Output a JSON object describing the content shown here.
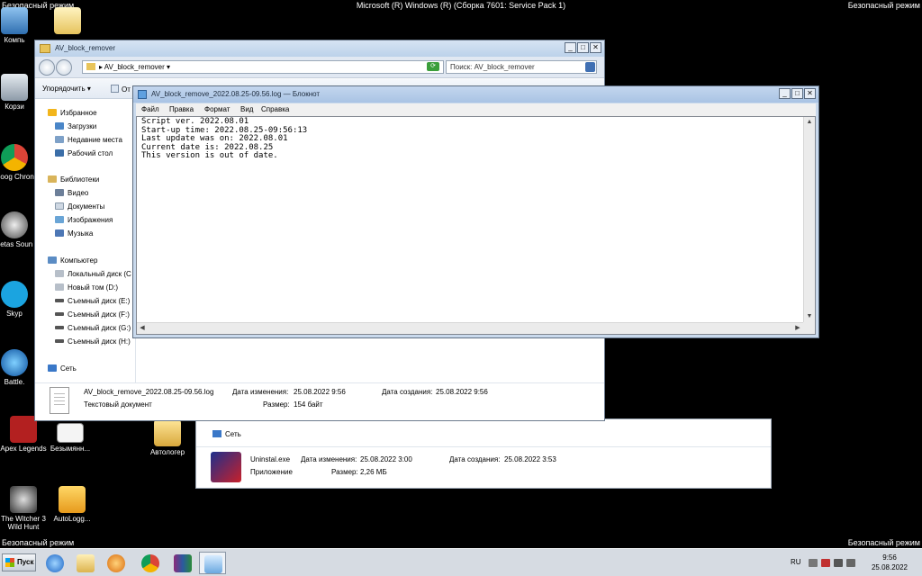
{
  "safe_mode": "Безопасный режим",
  "os_build": "Microsoft (R) Windows (R) (Сборка 7601: Service Pack 1)",
  "desktop_icons": [
    {
      "label": "Компь",
      "icon": "computer-icon"
    },
    {
      "label": "Корзи",
      "icon": "recycle-bin-icon"
    },
    {
      "label": "Goog Chron",
      "icon": "chrome-icon"
    },
    {
      "label": "Letas Soun",
      "icon": "audio-app-icon"
    },
    {
      "label": "Skyp",
      "icon": "skype-icon"
    },
    {
      "label": "Battle.",
      "icon": "battlenet-icon"
    },
    {
      "label": "Apex Legends",
      "icon": "apex-legends-icon"
    },
    {
      "label": "Безымянн...",
      "icon": "monitor-icon"
    },
    {
      "label": "Автологер",
      "icon": "folder-icon"
    },
    {
      "label": "The Witcher 3 Wild Hunt",
      "icon": "witcher-icon"
    },
    {
      "label": "AutoLogg...",
      "icon": "autologger-icon"
    }
  ],
  "explorer_main": {
    "title": "AV_block_remover",
    "address": "AV_block_remover",
    "search_placeholder": "Поиск: AV_block_remover",
    "toolbar": {
      "organize": "Упорядочить",
      "open": "От"
    },
    "nav": {
      "favorites": "Избранное",
      "downloads": "Загрузки",
      "recent": "Недавние места",
      "desktop": "Рабочий стол",
      "libraries": "Библиотеки",
      "video": "Видео",
      "documents": "Документы",
      "images": "Изображения",
      "music": "Музыка",
      "computer": "Компьютер",
      "local_disk": "Локальный диск (C",
      "new_volume": "Новый том (D:)",
      "removable_e": "Съемный диск (E:)",
      "removable_f": "Съемный диск (F:)",
      "removable_g": "Съемный диск (G:)",
      "removable_h": "Съемный диск (H:)",
      "network": "Сеть"
    },
    "details": {
      "file_name": "AV_block_remove_2022.08.25-09.56.log",
      "type": "Текстовый документ",
      "modified_label": "Дата изменения:",
      "modified": "25.08.2022 9:56",
      "created_label": "Дата создания:",
      "created": "25.08.2022 9:56",
      "size_label": "Размер:",
      "size": "154 байт"
    }
  },
  "explorer_back": {
    "network": "Сеть",
    "file_name": "Uninstal.exe",
    "type": "Приложение",
    "modified_label": "Дата изменения:",
    "modified": "25.08.2022 3:00",
    "created_label": "Дата создания:",
    "created": "25.08.2022 3:53",
    "size_label": "Размер:",
    "size": "2,26 МБ"
  },
  "notepad": {
    "title": "AV_block_remove_2022.08.25-09.56.log — Блокнот",
    "menu": [
      "Файл",
      "Правка",
      "Формат",
      "Вид",
      "Справка"
    ],
    "lines": [
      "Script ver. 2022.08.01",
      "Start-up time: 2022.08.25-09:56:13",
      "Last update was on: 2022.08.01",
      "Current date is: 2022.08.25",
      "This version is out of date."
    ]
  },
  "taskbar": {
    "start": "Пуск",
    "lang": "RU",
    "time": "9:56",
    "date": "25.08.2022"
  },
  "colors": {
    "desktop": "#000000",
    "titlebar": "#bcd2ea",
    "taskbar": "#d6dbe2"
  }
}
